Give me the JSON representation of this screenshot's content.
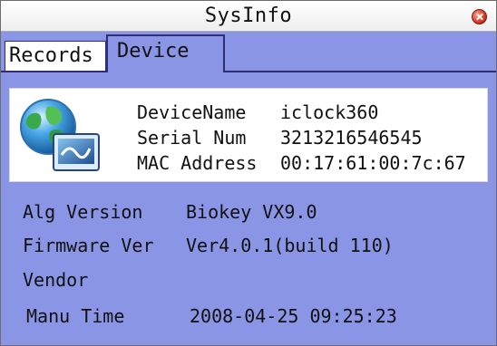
{
  "window": {
    "title": "SysInfo"
  },
  "tabs": [
    {
      "label": "Records",
      "active": false
    },
    {
      "label": "Device",
      "active": true
    }
  ],
  "device": {
    "rows": [
      {
        "label": "DeviceName",
        "value": "iclock360"
      },
      {
        "label": "Serial Num",
        "value": "3213216546545"
      },
      {
        "label": "MAC Address",
        "value": "00:17:61:00:7c:67"
      }
    ]
  },
  "details": [
    {
      "label": "Alg Version",
      "value": "Biokey VX9.0"
    },
    {
      "label": "Firmware Ver",
      "value": "Ver4.0.1(build 110)"
    },
    {
      "label": "Vendor",
      "value": ""
    },
    {
      "label": "Manu Time",
      "value": "2008-04-25  09:25:23"
    }
  ],
  "colors": {
    "background": "#8a95e6",
    "tab_border": "#2e2e78",
    "close_button": "#d63a22"
  },
  "icons": {
    "device": "globe-monitor-icon",
    "close": "close-icon"
  }
}
